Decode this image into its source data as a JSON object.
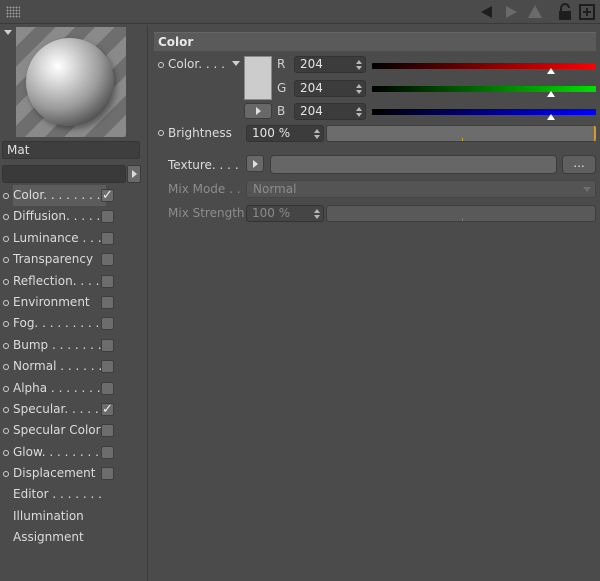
{
  "toolbar": {
    "icons": [
      "back-arrow-icon",
      "forward-arrow-icon",
      "up-arrow-icon",
      "lock-icon",
      "new-panel-icon"
    ]
  },
  "material": {
    "name": "Mat"
  },
  "channels": [
    {
      "label": "Color. . . . . . . .",
      "has_dot": true,
      "checkbox": true,
      "checked": true,
      "active": true
    },
    {
      "label": "Diffusion. . . . .",
      "has_dot": true,
      "checkbox": true,
      "checked": false
    },
    {
      "label": "Luminance . . .",
      "has_dot": true,
      "checkbox": true,
      "checked": false
    },
    {
      "label": "Transparency",
      "has_dot": true,
      "checkbox": true,
      "checked": false
    },
    {
      "label": "Reflection. . . .",
      "has_dot": true,
      "checkbox": true,
      "checked": false
    },
    {
      "label": "Environment",
      "has_dot": true,
      "checkbox": true,
      "checked": false
    },
    {
      "label": "Fog. . . . . . . . .",
      "has_dot": true,
      "checkbox": true,
      "checked": false
    },
    {
      "label": "Bump . . . . . . .",
      "has_dot": true,
      "checkbox": true,
      "checked": false
    },
    {
      "label": "Normal . . . . . .",
      "has_dot": true,
      "checkbox": true,
      "checked": false
    },
    {
      "label": "Alpha . . . . . . .",
      "has_dot": true,
      "checkbox": true,
      "checked": false
    },
    {
      "label": "Specular. . . . .",
      "has_dot": true,
      "checkbox": true,
      "checked": true
    },
    {
      "label": "Specular Color",
      "has_dot": true,
      "checkbox": true,
      "checked": false
    },
    {
      "label": "Glow. . . . . . . .",
      "has_dot": true,
      "checkbox": true,
      "checked": false
    },
    {
      "label": "Displacement",
      "has_dot": true,
      "checkbox": true,
      "checked": false
    },
    {
      "label": "Editor . . . . . . .",
      "has_dot": false,
      "checkbox": false
    },
    {
      "label": "Illumination",
      "has_dot": false,
      "checkbox": false
    },
    {
      "label": "Assignment",
      "has_dot": false,
      "checkbox": false
    }
  ],
  "color_section": {
    "title": "Color",
    "color_label": "Color. . . .",
    "swatch_color": "#cccccc",
    "r_label": "R",
    "r_value": "204",
    "r_level": 0.8,
    "g_label": "G",
    "g_value": "204",
    "g_level": 0.8,
    "b_label": "B",
    "b_value": "204",
    "b_level": 0.8,
    "brightness_label": "Brightness",
    "brightness_value": "100 %",
    "texture_label": "Texture. . . .",
    "texture_button": "...",
    "mix_mode_label": "Mix Mode . .",
    "mix_mode_value": "Normal",
    "mix_strength_label": "Mix Strength",
    "mix_strength_value": "100 %"
  },
  "colors": {
    "background": "#4b4b4b",
    "red": "#ff0000",
    "green": "#00e000",
    "blue": "#0000ff",
    "accent_tick": "#c9a23c"
  }
}
